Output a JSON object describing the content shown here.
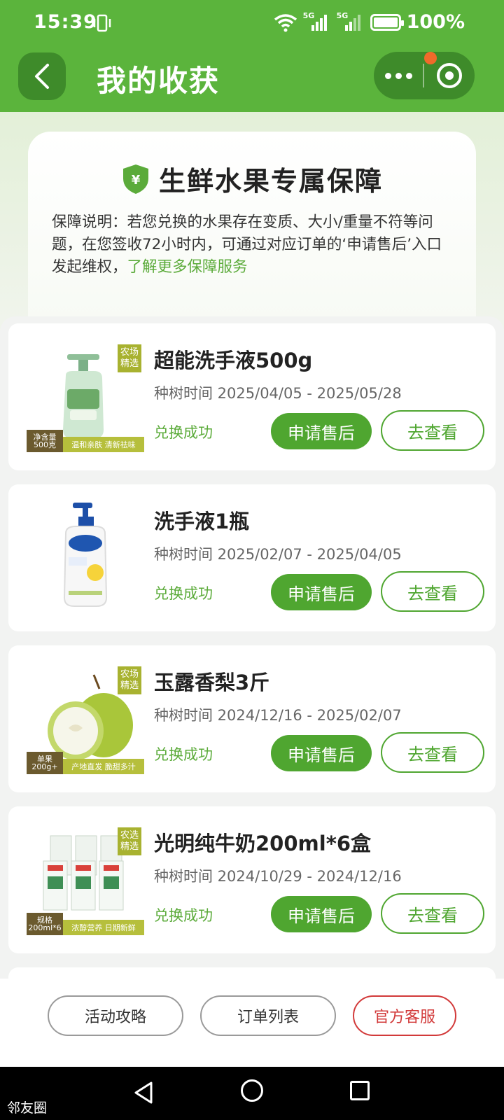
{
  "status_bar": {
    "time": "15:39",
    "net1": "5G",
    "net2": "5G",
    "battery": "100%"
  },
  "header": {
    "title": "我的收获"
  },
  "guarantee": {
    "title": "生鲜水果专属保障",
    "shield_symbol": "¥",
    "desc_before_link": "保障说明：若您兑换的水果存在变质、大小/重量不符等问题，在您签收72小时内，可通过对应订单的‘申请售后’入口发起维权，",
    "link_text": "了解更多保障服务"
  },
  "items": [
    {
      "title": "超能洗手液500g",
      "time": "种树时间 2025/04/05 - 2025/05/28",
      "status": "兑换成功",
      "after_sale_label": "申请售后",
      "view_label": "去查看",
      "tag": "农场精选",
      "spec": "净含量500克",
      "slogan": "温和亲肤 清新祛味",
      "image_icon": "hand-soap-bottle-icon"
    },
    {
      "title": "洗手液1瓶",
      "time": "种树时间 2025/02/07 - 2025/04/05",
      "status": "兑换成功",
      "after_sale_label": "申请售后",
      "view_label": "去查看",
      "image_icon": "safeguard-bottle-icon"
    },
    {
      "title": "玉露香梨3斤",
      "time": "种树时间 2024/12/16 - 2025/02/07",
      "status": "兑换成功",
      "after_sale_label": "申请售后",
      "view_label": "去查看",
      "tag": "农场精选",
      "spec": "单果200g+",
      "slogan": "产地直发 脆甜多汁",
      "image_icon": "pear-icon"
    },
    {
      "title": "光明纯牛奶200ml*6盒",
      "time": "种树时间 2024/10/29 - 2024/12/16",
      "status": "兑换成功",
      "after_sale_label": "申请售后",
      "view_label": "去查看",
      "tag": "农选精选",
      "spec": "规格200ml*6",
      "slogan": "浓醇营养 日期新鲜",
      "image_icon": "milk-cartons-icon"
    }
  ],
  "actions": {
    "guide": "活动攻略",
    "orders": "订单列表",
    "service": "官方客服"
  },
  "nav": {
    "label": "邻友圈"
  },
  "colors": {
    "brand_green": "#5bb43c",
    "dark_green": "#3e8b2a",
    "accent_red": "#d23a3a"
  }
}
